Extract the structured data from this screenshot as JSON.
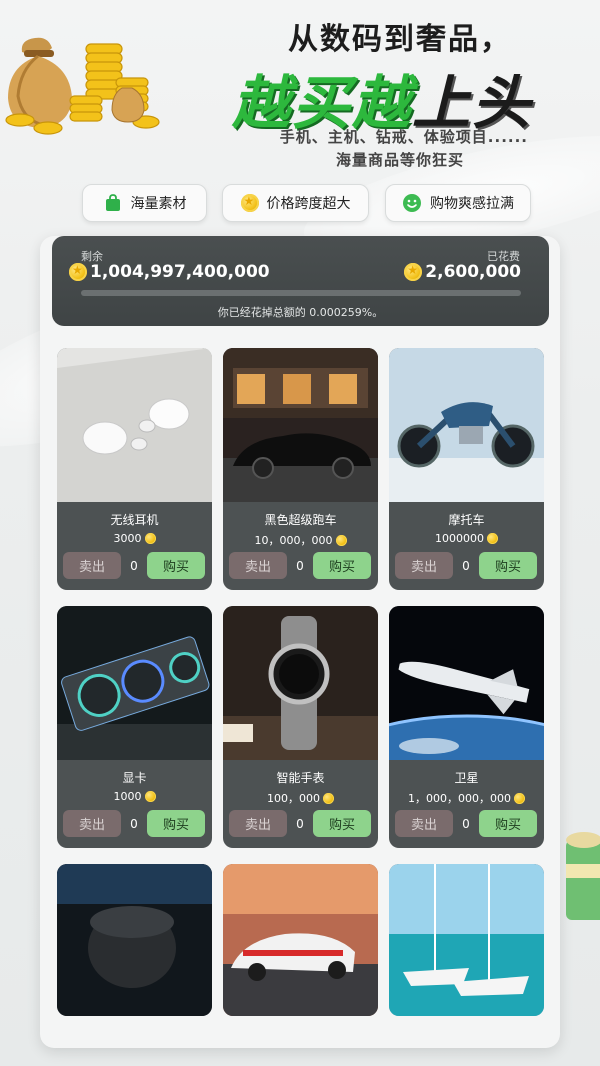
{
  "hero": {
    "title": "从数码到奢品，",
    "big_green_1": "越买越",
    "big_black": "上头",
    "sub1": "手机、主机、钻戒、体验项目......",
    "sub2": "海量商品等你狂买"
  },
  "pills": [
    {
      "label": "海量素材",
      "icon": "shopping-bag-icon",
      "color": "#2fb04a"
    },
    {
      "label": "价格跨度超大",
      "icon": "gold-coin-icon",
      "color": "#f3c21a"
    },
    {
      "label": "购物爽感拉满",
      "icon": "smile-icon",
      "color": "#3dbb52"
    }
  ],
  "stats": {
    "remaining_label": "剩余",
    "remaining_value": "1,004,997,400,000",
    "spent_label": "已花费",
    "spent_value": "2,600,000",
    "spent_fraction": 2.59e-06,
    "percent_text": "你已经花掉总额的 0.000259%。"
  },
  "products": [
    {
      "name": "无线耳机",
      "price": "3000",
      "count": "0",
      "sell": "卖出",
      "buy": "购买",
      "image": "earbuds"
    },
    {
      "name": "黑色超级跑车",
      "price": "10，000，000",
      "count": "0",
      "sell": "卖出",
      "buy": "购买",
      "image": "black-sports-car"
    },
    {
      "name": "摩托车",
      "price": "1000000",
      "count": "0",
      "sell": "卖出",
      "buy": "购买",
      "image": "motorcycle"
    },
    {
      "name": "显卡",
      "price": "1000",
      "count": "0",
      "sell": "卖出",
      "buy": "购买",
      "image": "graphics-card"
    },
    {
      "name": "智能手表",
      "price": "100，000",
      "count": "0",
      "sell": "卖出",
      "buy": "购买",
      "image": "smart-watch"
    },
    {
      "name": "卫星",
      "price": "1，000，000，000",
      "count": "0",
      "sell": "卖出",
      "buy": "购买",
      "image": "spacecraft"
    },
    {
      "name": "",
      "price": "",
      "image": "smart-speaker"
    },
    {
      "name": "",
      "price": "",
      "image": "race-car"
    },
    {
      "name": "",
      "price": "",
      "image": "sailing-yacht"
    }
  ],
  "colors": {
    "accent_green": "#2db83d",
    "buy_button": "#8ed38c",
    "sell_button": "#7a6b6c",
    "card_bg": "#4d5253",
    "coin": "#f3c21a"
  }
}
